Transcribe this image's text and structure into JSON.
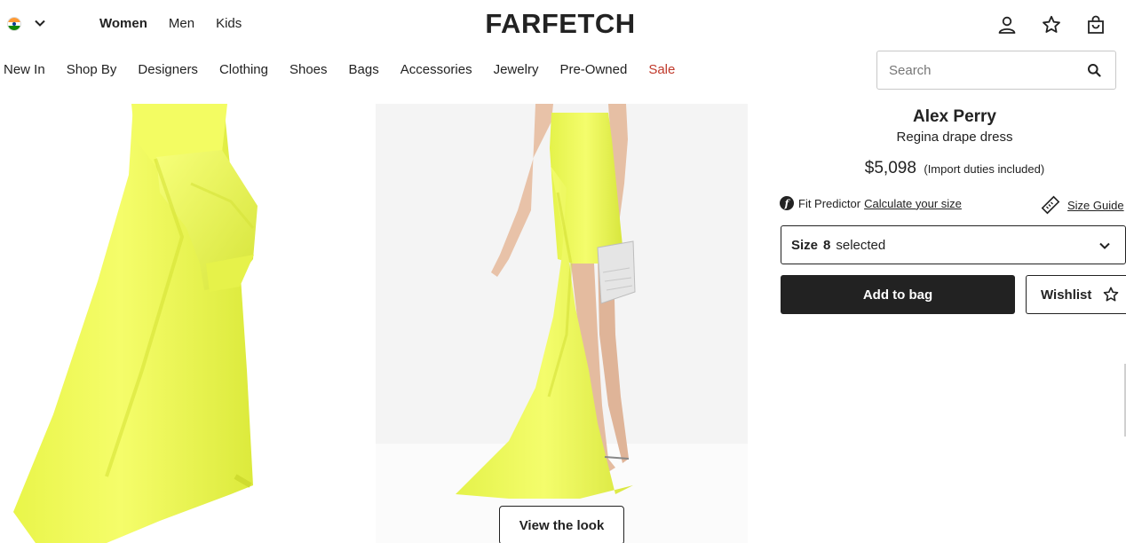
{
  "header": {
    "logo": "FARFETCH",
    "country_flag_icon": "india-flag-icon",
    "gender_tabs": [
      {
        "label": "Women",
        "active": true
      },
      {
        "label": "Men",
        "active": false
      },
      {
        "label": "Kids",
        "active": false
      }
    ],
    "icons": [
      "account-icon",
      "wishlist-star-icon",
      "shopping-bag-icon"
    ]
  },
  "nav": {
    "items": [
      "New In",
      "Shop By",
      "Designers",
      "Clothing",
      "Shoes",
      "Bags",
      "Accessories",
      "Jewelry",
      "Pre-Owned",
      "Sale"
    ],
    "sale_color": "#c0392b"
  },
  "search": {
    "placeholder": "Search",
    "value": ""
  },
  "gallery": {
    "view_look_label": "View the look",
    "dress_color": "#f1fb58"
  },
  "product": {
    "brand": "Alex Perry",
    "name": "Regina drape dress",
    "price": "$5,098",
    "duties": "(Import duties included)",
    "fit_predictor_label": "Fit Predictor",
    "fit_predictor_link": "Calculate your size",
    "size_guide_label": "Size Guide",
    "size_prefix": "Size",
    "size_value": "8",
    "size_suffix": "selected",
    "add_to_bag_label": "Add to bag",
    "wishlist_label": "Wishlist"
  }
}
